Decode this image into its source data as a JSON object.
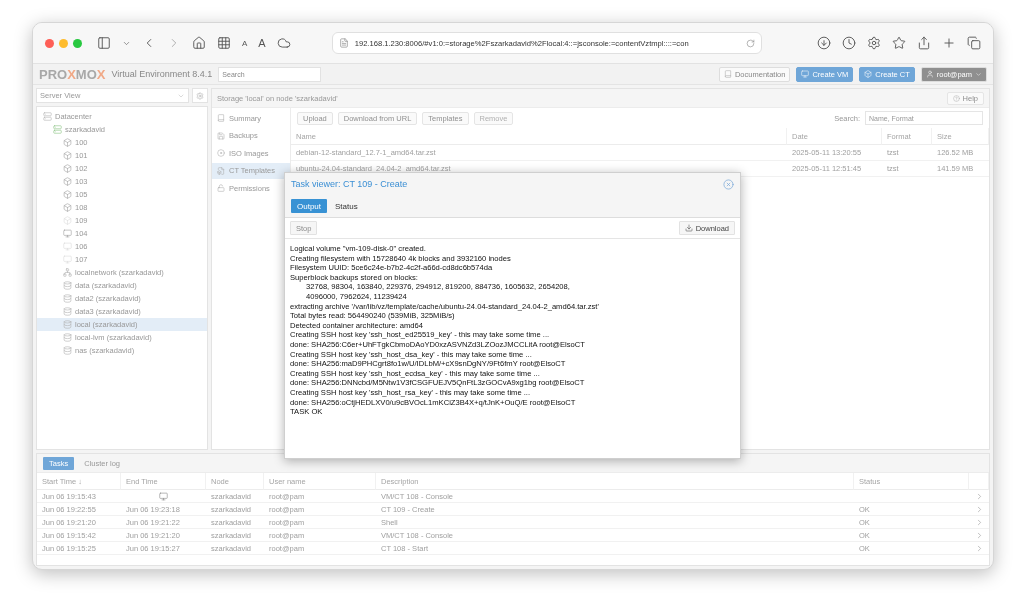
{
  "browser": {
    "text_size_buttons": [
      "A",
      "A"
    ],
    "url": "192.168.1.230:8006/#v1:0:=storage%2Fszarkadavid%2Flocal:4::=jsconsole:=contentVztmpl::::=con"
  },
  "header": {
    "logo_parts": [
      {
        "text": "PRO",
        "accent": false
      },
      {
        "text": "X",
        "accent": true
      },
      {
        "text": "MO",
        "accent": false
      },
      {
        "text": "X",
        "accent": true
      }
    ],
    "version": "Virtual Environment 8.4.1",
    "search": {
      "placeholder": "Search"
    },
    "buttons": [
      {
        "kind": "docs",
        "label": "Documentation"
      },
      {
        "kind": "create_vm",
        "label": "Create VM"
      },
      {
        "kind": "create_ct",
        "label": "Create CT"
      },
      {
        "kind": "user",
        "label": "root@pam"
      }
    ]
  },
  "sidebar": {
    "view": "Server View",
    "tree": [
      {
        "kind": "datacenter",
        "label": "Datacenter",
        "selected": false,
        "children": [
          {
            "kind": "node",
            "label": "szarkadavid",
            "selected": false,
            "children": [
              {
                "kind": "ct",
                "label": "100",
                "selected": false
              },
              {
                "kind": "ct",
                "label": "101",
                "selected": false
              },
              {
                "kind": "ct",
                "label": "102",
                "selected": false
              },
              {
                "kind": "ct",
                "label": "103",
                "selected": false
              },
              {
                "kind": "ct",
                "label": "105",
                "selected": false
              },
              {
                "kind": "ct",
                "label": "108",
                "selected": false
              },
              {
                "kind": "ct_stopped",
                "label": "109",
                "selected": false
              },
              {
                "kind": "vm",
                "label": "104",
                "selected": false
              },
              {
                "kind": "vm_stopped",
                "label": "106",
                "selected": false
              },
              {
                "kind": "vm_stopped",
                "label": "107",
                "selected": false
              },
              {
                "kind": "sdn",
                "label": "localnetwork (szarkadavid)",
                "selected": false
              },
              {
                "kind": "storage",
                "label": "data (szarkadavid)",
                "selected": false
              },
              {
                "kind": "storage",
                "label": "data2 (szarkadavid)",
                "selected": false
              },
              {
                "kind": "storage",
                "label": "data3 (szarkadavid)",
                "selected": false
              },
              {
                "kind": "storage",
                "label": "local (szarkadavid)",
                "selected": true
              },
              {
                "kind": "storage",
                "label": "local-lvm (szarkadavid)",
                "selected": false
              },
              {
                "kind": "storage",
                "label": "nas (szarkadavid)",
                "selected": false
              }
            ]
          }
        ]
      }
    ]
  },
  "content": {
    "title": "Storage 'local' on node 'szarkadavid'",
    "help": "Help",
    "nav": [
      {
        "kind": "summary",
        "label": "Summary",
        "selected": false
      },
      {
        "kind": "backups",
        "label": "Backups",
        "selected": false
      },
      {
        "kind": "iso",
        "label": "ISO Images",
        "selected": false
      },
      {
        "kind": "templates",
        "label": "CT Templates",
        "selected": true
      },
      {
        "kind": "permissions",
        "label": "Permissions",
        "selected": false
      }
    ],
    "toolbar": [
      {
        "label": "Upload",
        "disabled": false
      },
      {
        "label": "Download from URL",
        "disabled": false
      },
      {
        "label": "Templates",
        "disabled": false
      },
      {
        "label": "Remove",
        "disabled": true
      }
    ],
    "search": {
      "label": "Search:",
      "placeholder": "Name, Format"
    },
    "table": {
      "columns": [
        "Name",
        "Date",
        "Format",
        "Size"
      ],
      "rows": [
        [
          "debian-12-standard_12.7-1_amd64.tar.zst",
          "2025-05-11 13:20:55",
          "tzst",
          "126.52 MB"
        ],
        [
          "ubuntu-24.04-standard_24.04-2_amd64.tar.zst",
          "2025-05-11 12:51:45",
          "tzst",
          "141.59 MB"
        ]
      ]
    }
  },
  "task_viewer": {
    "title": "Task viewer: CT 109 - Create",
    "tabs": [
      {
        "label": "Output",
        "selected": true
      },
      {
        "label": "Status",
        "selected": false
      }
    ],
    "stop": {
      "label": "Stop",
      "disabled": true
    },
    "download": "Download",
    "log": [
      {
        "text": "Logical volume \"vm-109-disk-0\" created.",
        "indent": false
      },
      {
        "text": "Creating filesystem with 15728640 4k blocks and 3932160 inodes",
        "indent": false
      },
      {
        "text": "Filesystem UUID: 5ce6c24e-b7b2-4c2f-a66d-cd8dc6b574da",
        "indent": false
      },
      {
        "text": "Superblock backups stored on blocks:",
        "indent": false
      },
      {
        "text": "32768, 98304, 163840, 229376, 294912, 819200, 884736, 1605632, 2654208,",
        "indent": true
      },
      {
        "text": "4096000, 7962624, 11239424",
        "indent": true
      },
      {
        "text": "extracting archive '/var/lib/vz/template/cache/ubuntu-24.04-standard_24.04-2_amd64.tar.zst'",
        "indent": false
      },
      {
        "text": "Total bytes read: 564490240 (539MiB, 325MiB/s)",
        "indent": false
      },
      {
        "text": "Detected container architecture: amd64",
        "indent": false
      },
      {
        "text": "Creating SSH host key 'ssh_host_ed25519_key' - this may take some time ...",
        "indent": false
      },
      {
        "text": "done: SHA256:C6er+UhFTgkCbmoDAoYD0xzASVNZd3LZOozJMCCLitA root@ElsoCT",
        "indent": false
      },
      {
        "text": "Creating SSH host key 'ssh_host_dsa_key' - this may take some time ...",
        "indent": false
      },
      {
        "text": "done: SHA256:maD9PHCgrt8fo1w/U/IDLbM/+cX9snDgNY/9Ft6fmY root@ElsoCT",
        "indent": false
      },
      {
        "text": "Creating SSH host key 'ssh_host_ecdsa_key' - this may take some time ...",
        "indent": false
      },
      {
        "text": "done: SHA256:DNNcbd/M5Ntw1V3fCSGFUEJV5QnFtL3zGOCvA9xg1bg root@ElsoCT",
        "indent": false
      },
      {
        "text": "Creating SSH host key 'ssh_host_rsa_key' - this may take some time ...",
        "indent": false
      },
      {
        "text": "done: SHA256:oCtjHEDLXV0/u9cBVOcL1mKCiZ3B4X+q/tJnK+OuQ/E root@ElsoCT",
        "indent": false
      },
      {
        "text": "TASK OK",
        "indent": false
      }
    ]
  },
  "tasks": {
    "tabs": [
      {
        "label": "Tasks",
        "selected": true
      },
      {
        "label": "Cluster log",
        "selected": false
      }
    ],
    "columns": [
      "Start Time ↓",
      "End Time",
      "Node",
      "User name",
      "Description",
      "Status"
    ],
    "rows": [
      {
        "start": "Jun 06 19:15:43",
        "running": true,
        "node": "szarkadavid",
        "user": "root@pam",
        "description": "VM/CT 108 - Console"
      },
      {
        "start": "Jun 06 19:22:55",
        "end": "Jun 06 19:23:18",
        "running": false,
        "node": "szarkadavid",
        "user": "root@pam",
        "description": "CT 109 - Create",
        "status": "OK"
      },
      {
        "start": "Jun 06 19:21:20",
        "end": "Jun 06 19:21:22",
        "running": false,
        "node": "szarkadavid",
        "user": "root@pam",
        "description": "Shell",
        "status": "OK"
      },
      {
        "start": "Jun 06 19:15:42",
        "end": "Jun 06 19:21:20",
        "running": false,
        "node": "szarkadavid",
        "user": "root@pam",
        "description": "VM/CT 108 - Console",
        "status": "OK"
      },
      {
        "start": "Jun 06 19:15:25",
        "end": "Jun 06 19:15:27",
        "running": false,
        "node": "szarkadavid",
        "user": "root@pam",
        "description": "CT 108 - Start",
        "status": "OK"
      }
    ]
  }
}
